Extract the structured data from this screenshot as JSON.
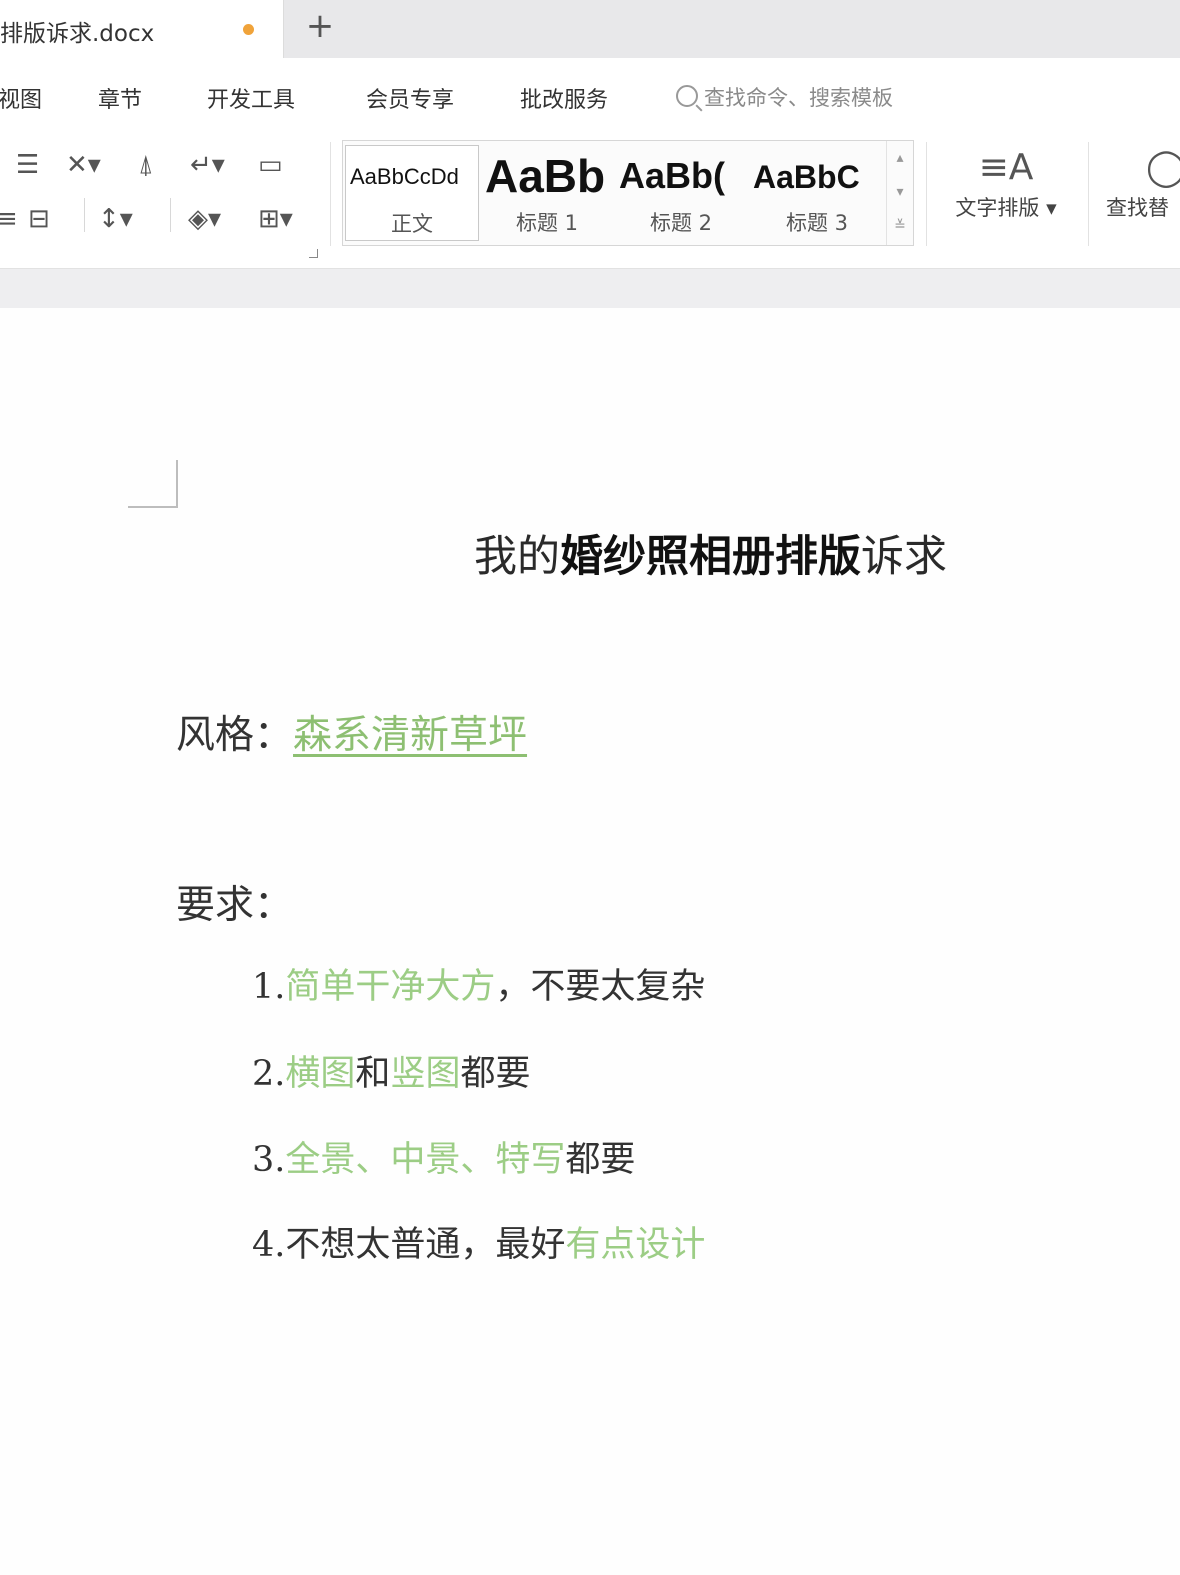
{
  "tab": {
    "title": "排版诉求.docx",
    "add": "+"
  },
  "menu": {
    "items": [
      "视图",
      "章节",
      "开发工具",
      "会员专享",
      "批改服务"
    ],
    "search_placeholder": "查找命令、搜索模板"
  },
  "ribbon": {
    "styles": [
      {
        "sample": "AaBbCcDd",
        "name": "正文"
      },
      {
        "sample": "AaBb",
        "name": "标题 1"
      },
      {
        "sample": "AaBb(",
        "name": "标题 2"
      },
      {
        "sample": "AaBbC",
        "name": "标题 3"
      }
    ],
    "text_layout_label": "文字排版",
    "find_label": "查找替"
  },
  "document": {
    "title_prefix": "我的",
    "title_bold": "婚纱照相册排版",
    "title_suffix": "诉求",
    "style_label": "风格：",
    "style_value": "森系清新草坪",
    "requirements_heading": "要求：",
    "items": [
      {
        "num": "1.",
        "green": "简单干净大方",
        "rest": "，不要太复杂"
      },
      {
        "num": "2.",
        "g1": "横图",
        "mid": "和",
        "g2": "竖图",
        "rest": "都要"
      },
      {
        "num": "3.",
        "green": "全景、中景、特写",
        "rest": "都要"
      },
      {
        "num": "4.",
        "plain": "不想太普通，最好",
        "green": "有点设计"
      }
    ]
  },
  "colors": {
    "accent_green": "#9ccd85",
    "unsaved_dot": "#f0a33a"
  }
}
